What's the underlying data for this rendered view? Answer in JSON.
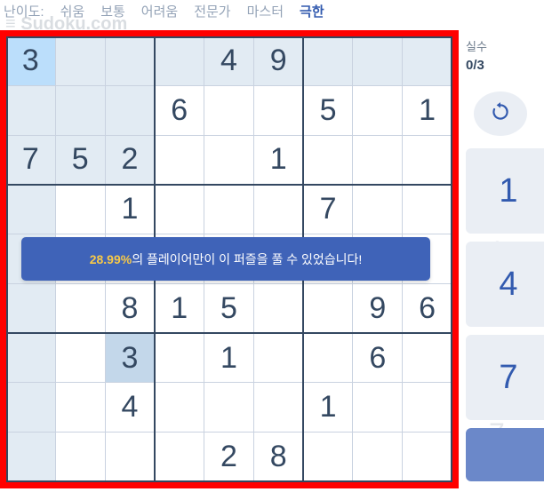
{
  "difficulty_nav": {
    "label": "난이도:",
    "options": [
      "쉬움",
      "보통",
      "어려움",
      "전문가",
      "마스터",
      "극한"
    ],
    "active": "극한"
  },
  "board": {
    "selected": [
      0,
      0
    ],
    "cells": [
      [
        "3",
        "",
        "",
        "",
        "4",
        "9",
        "",
        "",
        ""
      ],
      [
        "",
        "",
        "",
        "6",
        "",
        "",
        "5",
        "",
        "1"
      ],
      [
        "7",
        "5",
        "2",
        "",
        "",
        "1",
        "",
        "",
        ""
      ],
      [
        "",
        "",
        "1",
        "",
        "",
        "",
        "7",
        "",
        ""
      ],
      [
        "",
        "",
        "",
        "",
        "",
        "",
        "",
        "",
        ""
      ],
      [
        "",
        "",
        "8",
        "1",
        "5",
        "",
        "",
        "9",
        "6"
      ],
      [
        "",
        "",
        "3",
        "",
        "1",
        "",
        "",
        "6",
        ""
      ],
      [
        "",
        "",
        "4",
        "",
        "",
        "",
        "1",
        "",
        ""
      ],
      [
        "",
        "",
        "",
        "",
        "2",
        "8",
        "",
        "",
        ""
      ]
    ]
  },
  "banner": {
    "percent": "28.99%",
    "text": "의 플레이어만이 이 퍼즐을 풀 수 있었습니다!"
  },
  "mistakes": {
    "label": "실수",
    "value": "0/3"
  },
  "numpad": [
    "1",
    "4",
    "7",
    ""
  ],
  "colors": {
    "frame": "#ff0000",
    "banner": "#3f63b8",
    "accent": "#325aaf",
    "highlight": "#e2ebf3"
  }
}
